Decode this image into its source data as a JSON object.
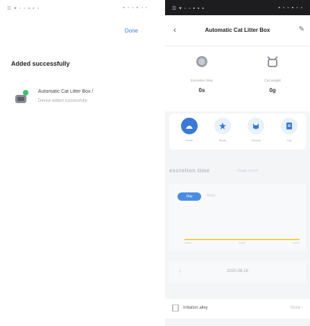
{
  "left_screen": {
    "status_left": "☰ ▾ ◦ ◦ ▪ ▪ ▫",
    "status_right": "▪ ▫ ▫ ▪ ▫ ▫",
    "done_label": "Done",
    "title": "Added successfully",
    "device": {
      "name": "Automatic Cat Litter Box  /",
      "status": "Device added successfully",
      "badge_color": "#3fbf6f"
    }
  },
  "right_screen": {
    "status_left": "☰ ▾ ◦ ◦ ▪ ▪ ▪",
    "status_right": "▪ ▫ ▫ ▪ ▫ ▫",
    "nav": {
      "back": "‹",
      "title": "Automatic Cat Litter Box",
      "edit": "✎"
    },
    "stats": [
      {
        "icon": "clock-icon",
        "label": "Excretion time",
        "value": "0s"
      },
      {
        "icon": "scale-icon",
        "label": "Cat weight",
        "value": "0g"
      }
    ],
    "actions": [
      {
        "icon": "clean-icon",
        "label": "Clean",
        "active": true
      },
      {
        "icon": "star-icon",
        "label": "Mode",
        "active": false
      },
      {
        "icon": "cat-icon",
        "label": "Cat info",
        "active": false
      },
      {
        "icon": "doc-icon",
        "label": "Log",
        "active": false
      }
    ],
    "section_title": "excretion time",
    "section_sub": "Usage record",
    "chart": {
      "active_tab": "Day",
      "other_tab": "Week",
      "line_color": "#f0c419"
    },
    "date_row": {
      "prev": "‹",
      "text": "2020-08-18"
    },
    "bottom": {
      "label": "Irritation alley",
      "right": "None ›"
    },
    "accent_color": "#3a7ad6"
  }
}
